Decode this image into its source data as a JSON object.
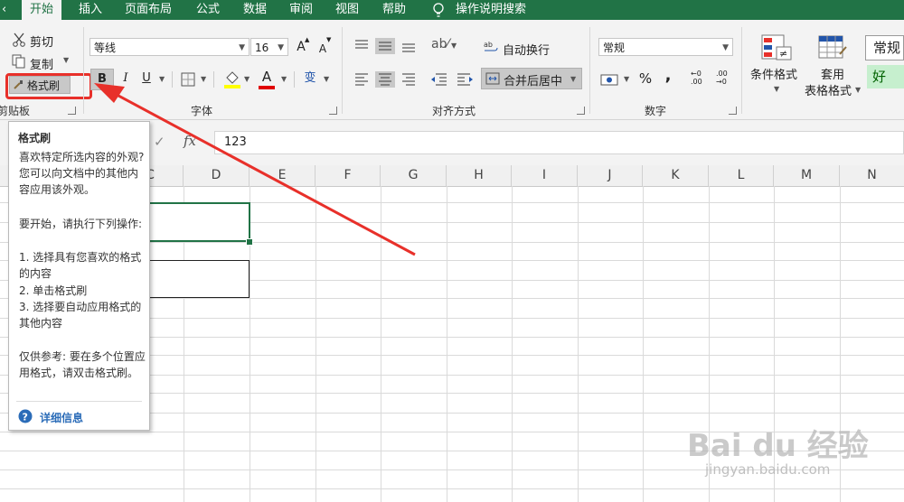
{
  "menu": {
    "items": [
      "开始",
      "插入",
      "页面布局",
      "公式",
      "数据",
      "审阅",
      "视图",
      "帮助"
    ],
    "search": "操作说明搜索"
  },
  "clipboard": {
    "cut": "剪切",
    "copy": "复制",
    "painter": "格式刷",
    "label": "剪贴板"
  },
  "font": {
    "name": "等线",
    "size": "16",
    "label": "字体",
    "grow": "A",
    "shrink": "A",
    "bold": "B",
    "italic": "I",
    "underline": "U",
    "font_color_glyph": "A",
    "phonetic": "变"
  },
  "align": {
    "wrap": "自动换行",
    "merge": "合并后居中",
    "label": "对齐方式"
  },
  "number": {
    "format": "常规",
    "percent": "%",
    "comma": ",",
    "label": "数字",
    "inc_decimal": "←0 .00",
    "dec_decimal": ".00 →0"
  },
  "styles": {
    "conditional": "条件格式",
    "table_line1": "套用",
    "table_line2": "表格格式",
    "style_normal": "常规",
    "style_good": "好"
  },
  "formula": {
    "fx": "fx",
    "value": "123"
  },
  "columns": [
    "C",
    "D",
    "E",
    "F",
    "G",
    "H",
    "I",
    "J",
    "K",
    "L",
    "M",
    "N"
  ],
  "tooltip": {
    "title": "格式刷",
    "p1": "喜欢特定所选内容的外观? 您可以向文档中的其他内容应用该外观。",
    "p2": "要开始，请执行下列操作:",
    "s1": "1. 选择具有您喜欢的格式的内容",
    "s2": "2. 单击格式刷",
    "s3": "3. 选择要自动应用格式的其他内容",
    "p3": "仅供参考: 要在多个位置应用格式，请双击格式刷。",
    "more": "详细信息"
  },
  "watermark": {
    "brand": "Bai du 经验",
    "url": "jingyan.baidu.com"
  },
  "colors": {
    "excel_green": "#217346",
    "annotation_red": "#e8302a",
    "good_bg": "#c6efce",
    "good_text": "#006100"
  }
}
